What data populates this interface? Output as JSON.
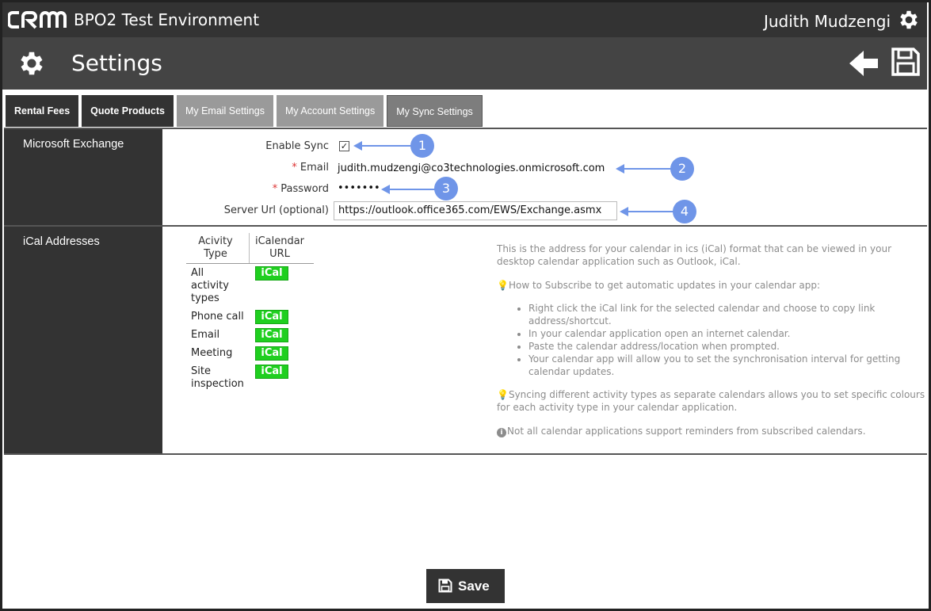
{
  "app": {
    "logo_text": "CRM",
    "title": "BPO2 Test Environment",
    "user_name": "Judith Mudzengi"
  },
  "header": {
    "page_title": "Settings",
    "back_icon": "arrow-left-icon",
    "save_icon": "floppy-icon"
  },
  "tabs": [
    {
      "label": "Rental Fees"
    },
    {
      "label": "Quote Products"
    },
    {
      "label": "My Email Settings"
    },
    {
      "label": "My Account Settings"
    },
    {
      "label": "My Sync Settings"
    }
  ],
  "exchange": {
    "section_label": "Microsoft Exchange",
    "enable_sync_label": "Enable Sync",
    "enable_sync_checked": "✓",
    "email_label": "Email",
    "email_value": "judith.mudzengi@co3technologies.onmicrosoft.com",
    "password_label": "Password",
    "password_value": "•••••••",
    "server_url_label": "Server Url (optional)",
    "server_url_value": "https://outlook.office365.com/EWS/Exchange.asmx",
    "required_marker": "*",
    "callouts": [
      "1",
      "2",
      "3",
      "4"
    ]
  },
  "ical": {
    "section_label": "iCal Addresses",
    "col_type": "Acivity Type",
    "col_url": "iCalendar URL",
    "rows": [
      {
        "type": "All activity types",
        "btn": "iCal"
      },
      {
        "type": "Phone call",
        "btn": "iCal"
      },
      {
        "type": "Email",
        "btn": "iCal"
      },
      {
        "type": "Meeting",
        "btn": "iCal"
      },
      {
        "type": "Site inspection",
        "btn": "iCal"
      }
    ],
    "help_intro": "This is the address for your calendar in ics (iCal) format that can be viewed in your desktop calendar application such as Outlook, iCal.",
    "help_subscribe": "How to Subscribe to get automatic updates in your calendar app:",
    "help_steps": [
      "Right click the iCal link for the selected calendar and choose to copy link address/shortcut.",
      "In your calendar application open an internet calendar.",
      "Paste the calendar address/location when prompted.",
      "Your calendar app will allow you to set the synchronisation interval for getting calendar updates."
    ],
    "help_colours": "Syncing different activity types as separate calendars allows you to set specific colours for each activity type in your calendar application.",
    "help_reminders": "Not all calendar applications support reminders from subscribed calendars."
  },
  "footer": {
    "save_label": "Save"
  },
  "colors": {
    "topbar": "#333333",
    "headerbar": "#444444",
    "ical_green": "#1fcf1f",
    "callout_blue": "#6f95e8"
  }
}
